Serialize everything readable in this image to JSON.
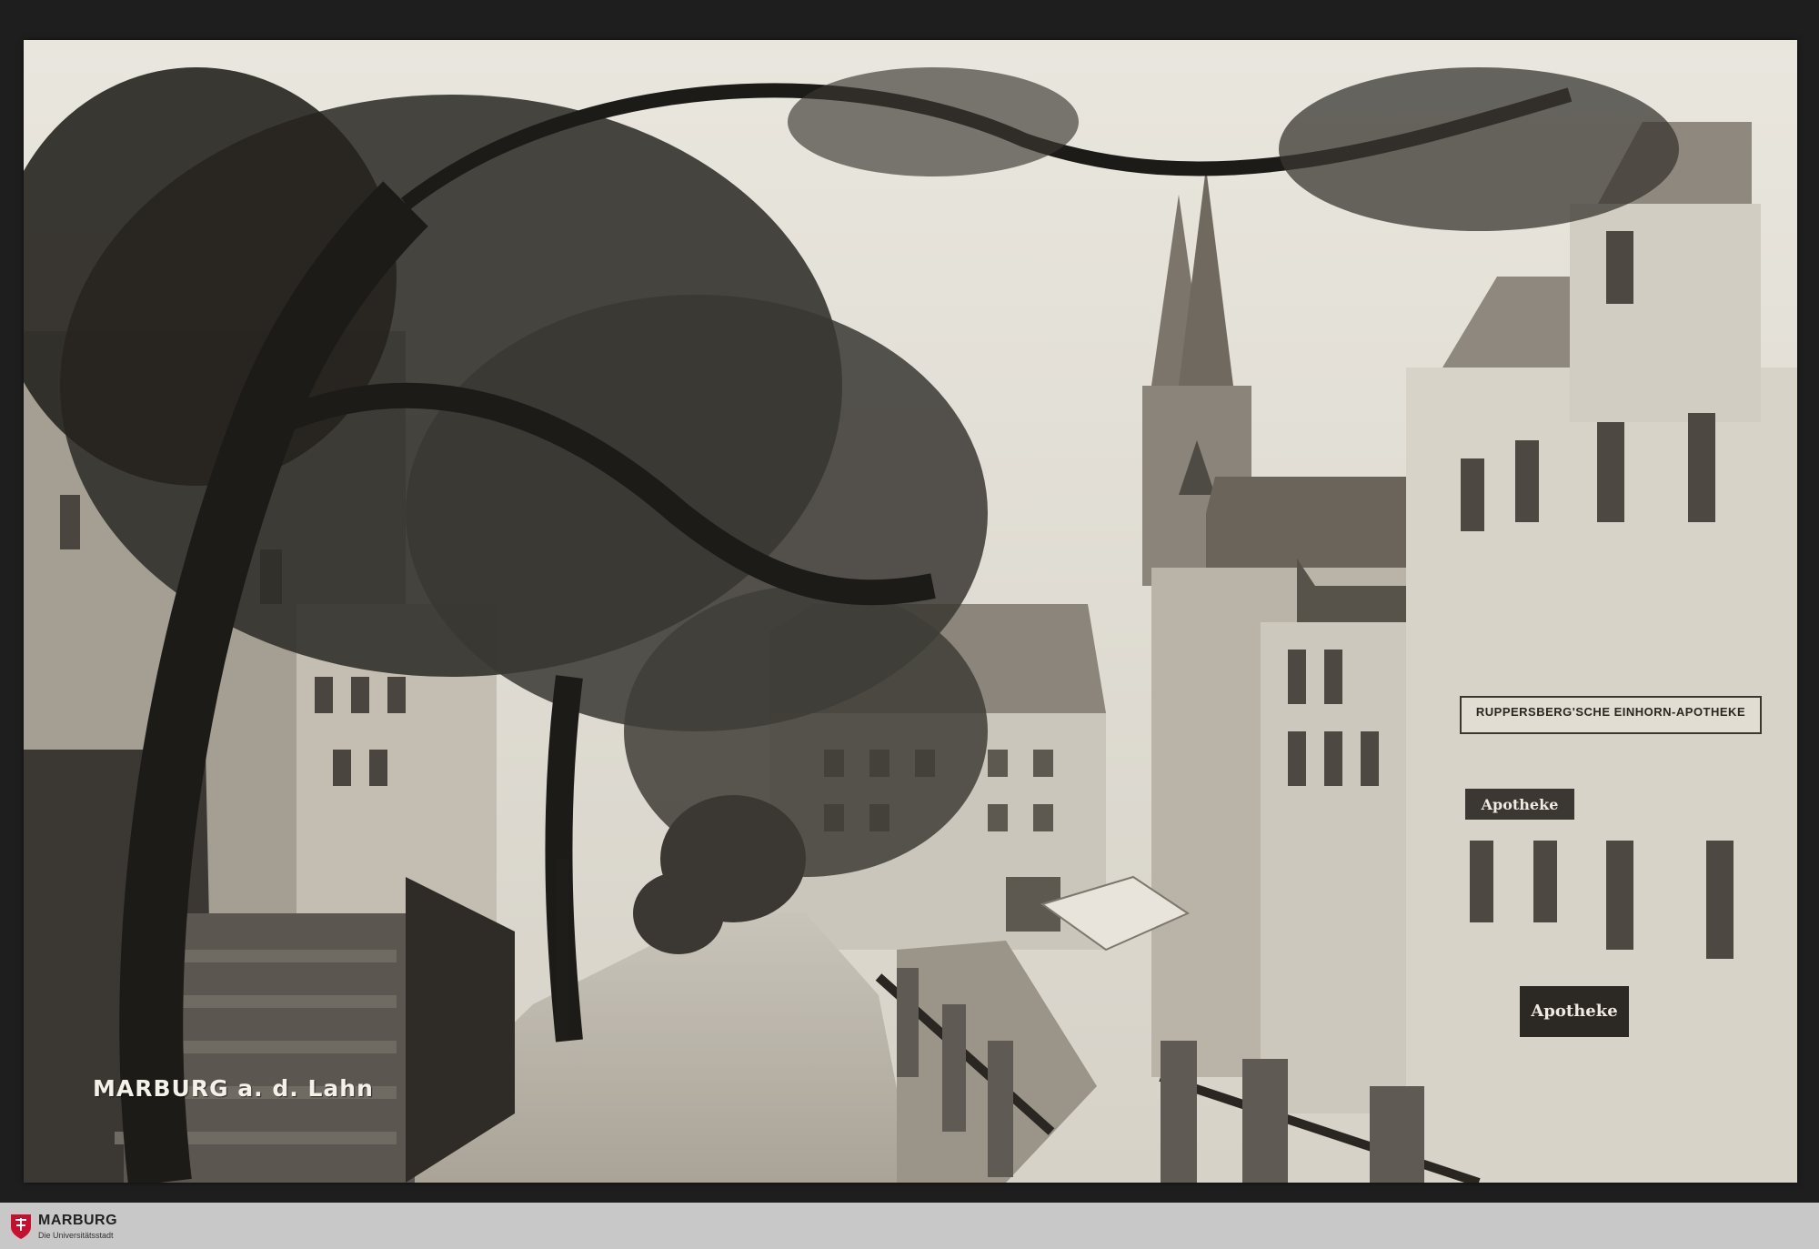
{
  "postcard": {
    "caption": "MARBURG a. d. Lahn",
    "shop_signs": {
      "pharmacy_facade": "RUPPERSBERG'SCHE EINHORN-APOTHEKE",
      "pharmacy_sign_upper": "Apotheke",
      "pharmacy_sign_lower": "Apotheke"
    }
  },
  "footer": {
    "logo_icon": "marburg-crest-icon",
    "name": "MARBURG",
    "tagline": "Die Universitätsstadt",
    "accent_color": "#c8102e"
  }
}
